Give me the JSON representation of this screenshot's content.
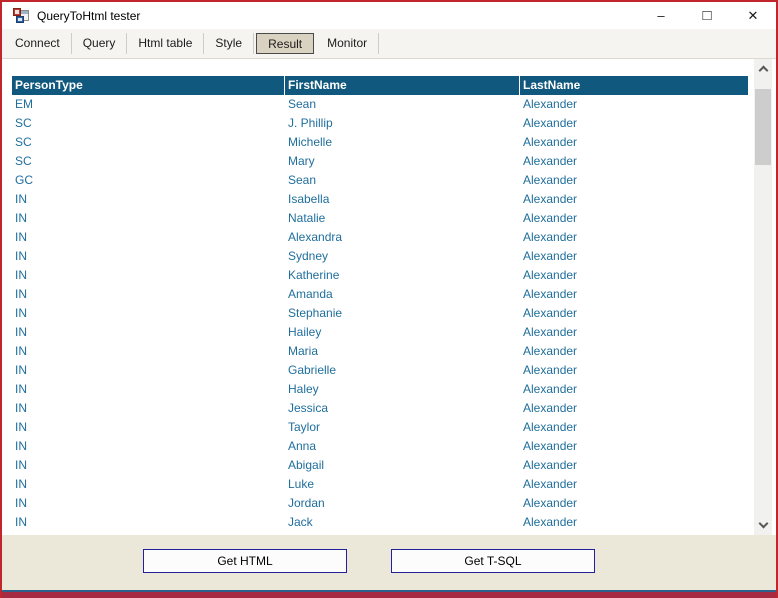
{
  "window": {
    "title": "QueryToHtml tester",
    "controls": {
      "minimize": "–",
      "maximize": "□",
      "close": "✕"
    }
  },
  "tabs": [
    {
      "label": "Connect",
      "selected": false
    },
    {
      "label": "Query",
      "selected": false
    },
    {
      "label": "Html table",
      "selected": false
    },
    {
      "label": "Style",
      "selected": false
    },
    {
      "label": "Result",
      "selected": true
    },
    {
      "label": "Monitor",
      "selected": false
    }
  ],
  "table": {
    "columns": [
      "PersonType",
      "FirstName",
      "LastName"
    ],
    "rows": [
      [
        "EM",
        "Sean",
        "Alexander"
      ],
      [
        "SC",
        "J. Phillip",
        "Alexander"
      ],
      [
        "SC",
        "Michelle",
        "Alexander"
      ],
      [
        "SC",
        "Mary",
        "Alexander"
      ],
      [
        "GC",
        "Sean",
        "Alexander"
      ],
      [
        "IN",
        "Isabella",
        "Alexander"
      ],
      [
        "IN",
        "Natalie",
        "Alexander"
      ],
      [
        "IN",
        "Alexandra",
        "Alexander"
      ],
      [
        "IN",
        "Sydney",
        "Alexander"
      ],
      [
        "IN",
        "Katherine",
        "Alexander"
      ],
      [
        "IN",
        "Amanda",
        "Alexander"
      ],
      [
        "IN",
        "Stephanie",
        "Alexander"
      ],
      [
        "IN",
        "Hailey",
        "Alexander"
      ],
      [
        "IN",
        "Maria",
        "Alexander"
      ],
      [
        "IN",
        "Gabrielle",
        "Alexander"
      ],
      [
        "IN",
        "Haley",
        "Alexander"
      ],
      [
        "IN",
        "Jessica",
        "Alexander"
      ],
      [
        "IN",
        "Taylor",
        "Alexander"
      ],
      [
        "IN",
        "Anna",
        "Alexander"
      ],
      [
        "IN",
        "Abigail",
        "Alexander"
      ],
      [
        "IN",
        "Luke",
        "Alexander"
      ],
      [
        "IN",
        "Jordan",
        "Alexander"
      ],
      [
        "IN",
        "Jack",
        "Alexander"
      ]
    ]
  },
  "buttons": {
    "get_html": "Get HTML",
    "get_tsql": "Get T-SQL"
  },
  "colors": {
    "window_border": "#C2262D",
    "table_header_bg": "#10587E",
    "row_text": "#1F6E9C",
    "tab_selected_bg": "#D9D2C0",
    "bottom_panel_bg": "#EBE7D9",
    "button_border": "#21219C",
    "accent_line": "#2E608C",
    "accent_band": "#A62A42",
    "scroll_thumb": "#CDCDCD"
  }
}
